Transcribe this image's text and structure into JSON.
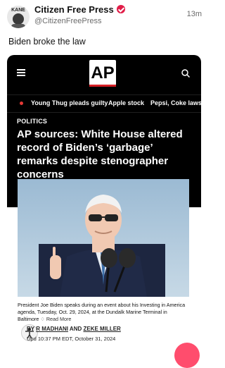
{
  "post": {
    "avatar_text": "KANE",
    "display_name": "Citizen Free Press",
    "handle": "@CitizenFreePress",
    "time": "13m",
    "text": "Biden broke the law"
  },
  "embed": {
    "logo": "AP",
    "ticker": [
      "Young Thug pleads guilty",
      "Apple stock",
      "Pepsi, Coke laws"
    ],
    "category": "POLITICS",
    "headline": "AP sources: White House altered record of Biden’s ‘garbage’ remarks despite stenographer concerns",
    "caption": "President Joe Biden speaks during an event about his Investing in America agenda, Tuesday, Oct. 29, 2024, at the Dundalk Marine Terminal in Baltimore",
    "read_more": "Read More",
    "byline_prefix": "BY",
    "author1": "R MADHANI",
    "and": "AND",
    "author2": "ZEKE MILLER",
    "date_prefix": "Up",
    "date": "d 10:37 PM EDT, October 31, 2024"
  },
  "icons": [
    "verified-badge-icon",
    "menu-icon",
    "search-icon",
    "accessibility-icon",
    "floating-action-button"
  ],
  "colors": {
    "ap_red": "#d61f26",
    "ticker_dot": "#e53935",
    "verified": "#e11d48",
    "fab": "#ff4d6d"
  }
}
